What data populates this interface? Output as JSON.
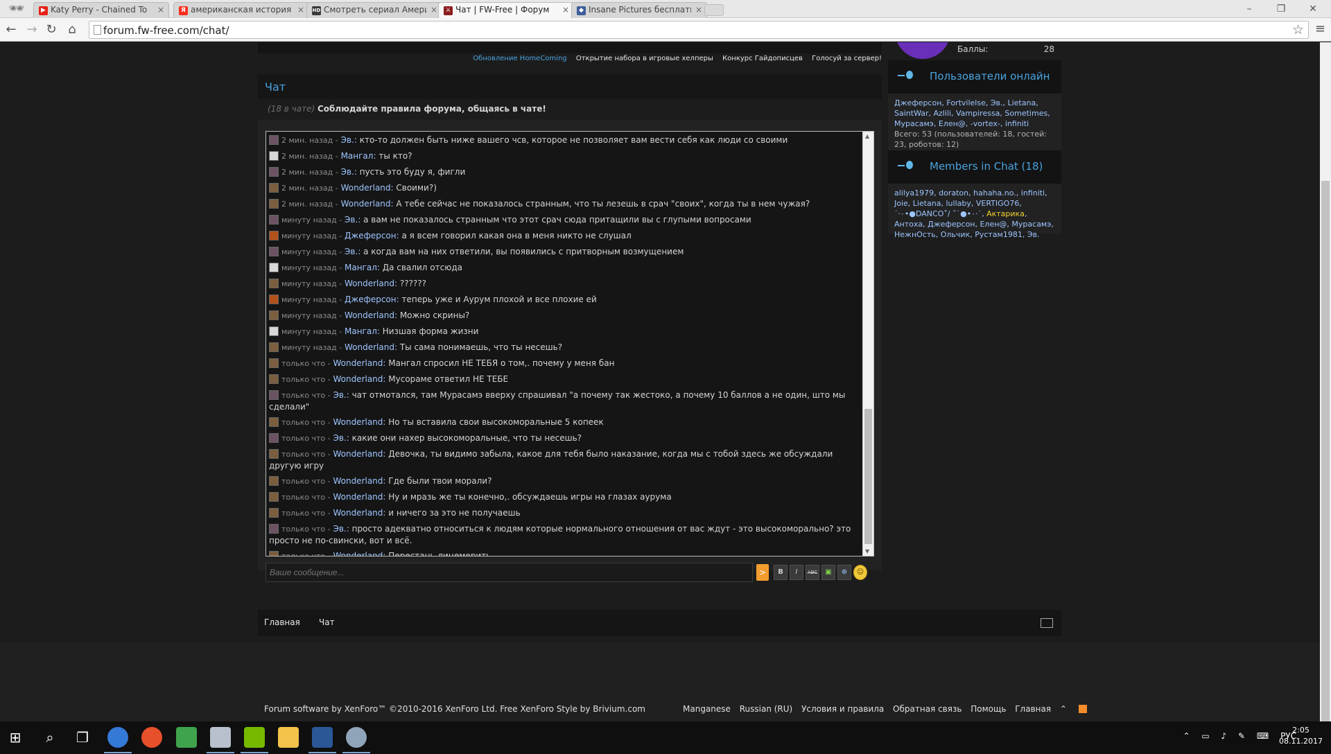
{
  "browser": {
    "tabs": [
      {
        "title": "Katy Perry - Chained To",
        "favicon_color": "#e62117",
        "favicon_glyph": "▶"
      },
      {
        "title": "американская история у",
        "favicon_color": "#ff2f1f",
        "favicon_glyph": "Я"
      },
      {
        "title": "Смотреть сериал Америк",
        "favicon_color": "#3a3a3a",
        "favicon_glyph": "HD"
      },
      {
        "title": "Чат | FW-Free | Форум",
        "favicon_color": "#8c1d1d",
        "favicon_glyph": "⚔"
      },
      {
        "title": "Insane Pictures бесплатн",
        "favicon_color": "#3d5f9a",
        "favicon_glyph": "◆"
      }
    ],
    "url": "forum.fw-free.com/chat/"
  },
  "notices": [
    "Обновление HomeComing",
    "Открытие набора в игровые хелперы",
    "Конкурс Гайдописцев",
    "Голосуй за сервер!"
  ],
  "chat": {
    "title": "Чат",
    "count": "(18 в чате)",
    "rules": "Соблюдайте правила форума, общаясь в чате!",
    "messages": [
      {
        "av": "ev",
        "time": "2 мин. назад -",
        "user": "Эв.:",
        "text": "кто-то должен быть ниже вашего чсв, которое не позволяет вам вести себя как люди со своими"
      },
      {
        "av": "ma",
        "time": "2 мин. назад -",
        "user": "Мангал:",
        "text": "ты кто?"
      },
      {
        "av": "ev",
        "time": "2 мин. назад -",
        "user": "Эв.:",
        "text": "пусть это буду я, фигли"
      },
      {
        "av": "wo",
        "time": "2 мин. назад -",
        "user": "Wonderland:",
        "text": "Своими?)"
      },
      {
        "av": "wo",
        "time": "2 мин. назад -",
        "user": "Wonderland:",
        "text": "А тебе сейчас не показалось странным, что ты лезешь в срач \"своих\", когда ты в нем чужая?"
      },
      {
        "av": "ev",
        "time": "минуту назад -",
        "user": "Эв.:",
        "text": "а вам не показалось странным что этот срач сюда притащили вы с глупыми вопросами"
      },
      {
        "av": "dj",
        "time": "минуту назад -",
        "user": "Джеферсон:",
        "text": "а я всем говорил какая она в меня никто не слушал"
      },
      {
        "av": "ev",
        "time": "минуту назад -",
        "user": "Эв.:",
        "text": "а когда вам на них ответили, вы появились с притворным возмущением"
      },
      {
        "av": "ma",
        "time": "минуту назад -",
        "user": "Мангал:",
        "text": "Да свалил отсюда"
      },
      {
        "av": "wo",
        "time": "минуту назад -",
        "user": "Wonderland:",
        "text": "??????"
      },
      {
        "av": "dj",
        "time": "минуту назад -",
        "user": "Джеферсон:",
        "text": "теперь уже и Аурум плохой и все плохие ей"
      },
      {
        "av": "wo",
        "time": "минуту назад -",
        "user": "Wonderland:",
        "text": "Можно скрины?"
      },
      {
        "av": "ma",
        "time": "минуту назад -",
        "user": "Мангал:",
        "text": "Низшая форма жизни"
      },
      {
        "av": "wo",
        "time": "минуту назад -",
        "user": "Wonderland:",
        "text": "Ты сама понимаешь, что ты несешь?"
      },
      {
        "av": "wo",
        "time": "только что -",
        "user": "Wonderland:",
        "text": "Мангал спросил НЕ ТЕБЯ о том,. почему у меня бан"
      },
      {
        "av": "wo",
        "time": "только что -",
        "user": "Wonderland:",
        "text": "Мусораме ответил НЕ ТЕБЕ"
      },
      {
        "av": "ev",
        "time": "только что -",
        "user": "Эв.:",
        "text": "чат отмотался, там Мурасамэ вверху спрашивал \"а почему так жестоко, а почему 10 баллов а не один, што мы сделали\""
      },
      {
        "av": "wo",
        "time": "только что -",
        "user": "Wonderland:",
        "text": "Но ты вставила свои высокоморальные 5 копеек"
      },
      {
        "av": "ev",
        "time": "только что -",
        "user": "Эв.:",
        "text": "какие они нахер высокоморальные, что ты несешь?"
      },
      {
        "av": "wo",
        "time": "только что -",
        "user": "Wonderland:",
        "text": "Девочка, ты видимо забыла, какое для тебя было наказание, когда мы с тобой здесь же обсуждали другую игру"
      },
      {
        "av": "wo",
        "time": "только что -",
        "user": "Wonderland:",
        "text": "Где были твои морали?"
      },
      {
        "av": "wo",
        "time": "только что -",
        "user": "Wonderland:",
        "text": "Ну и мразь же ты конечно,. обсуждаешь игры на глазах аурума"
      },
      {
        "av": "wo",
        "time": "только что -",
        "user": "Wonderland:",
        "text": "и ничего за это не получаешь"
      },
      {
        "av": "ev",
        "time": "только что -",
        "user": "Эв.:",
        "text": "просто адекватно относиться к людям которые нормального отношения от вас ждут - это высокоморально? это просто не по-свински, вот и всё."
      },
      {
        "av": "wo",
        "time": "только что -",
        "user": "Wonderland:",
        "text": "Перестань лицемерить"
      }
    ],
    "input_placeholder": "Ваше сообщение...",
    "send_label": ">",
    "format_buttons": [
      "B",
      "I",
      "ABC",
      "▣",
      "⊕",
      "☺"
    ]
  },
  "nav": {
    "home": "Главная",
    "chat": "Чат"
  },
  "footer": {
    "copyright": "Forum software by XenForo™ ©2010-2016 XenForo Ltd. Free XenForo Style by Brivium.com",
    "links": [
      "Manganese",
      "Russian (RU)",
      "Условия и правила",
      "Обратная связь",
      "Помощь",
      "Главная"
    ]
  },
  "sidebar": {
    "points_label": "Баллы:",
    "points_value": "28",
    "online": {
      "title": "Пользователи онлайн",
      "users": "Джеферсон, Fortvilelse, Эв., Lietana, SaintWar, Azlili, Vampiressa, Sometimes, Мурасамэ, Елен@, -vortex-, infiniti",
      "total": "Всего: 53 (пользователей: 18, гостей: 23, роботов: 12)"
    },
    "chat_members": {
      "title": "Members in Chat (18)",
      "before": "alilya1979, doraton, hahaha.no., infiniti, Joie, Lietana, lullaby, VERTIGO76, ˙·٠•●DANCO˚/ ˜˙●•٠·˙,",
      "highlight": "Актарика",
      "after": ", Антоха, Джеферсон, Елен@, Мурасамэ, НежнОсть, Ольчик, Рустам1981, Эв."
    }
  },
  "taskbar": {
    "lang": "РУС",
    "time": "2:05",
    "date": "08.11.2017"
  }
}
